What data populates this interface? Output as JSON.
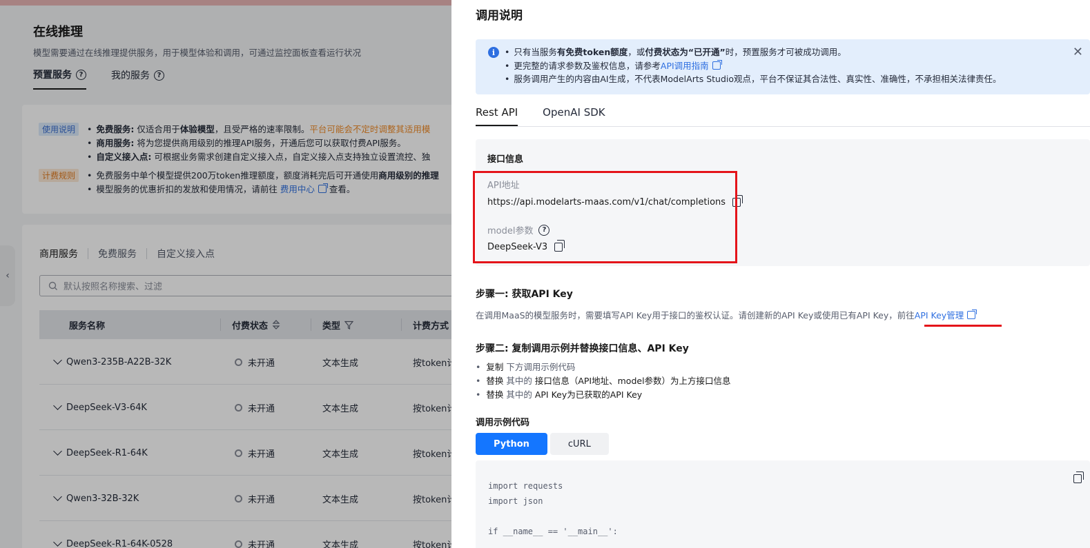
{
  "bg": {
    "title": "在线推理",
    "subtitle": "模型需要通过在线推理提供服务，用于模型体验和调用，可通过监控面板查看运行状况",
    "tabs": [
      "预置服务",
      "我的服务"
    ],
    "usage_tag": "使用说明",
    "usage_items": [
      {
        "bold": "免费服务:",
        "text": " 仅适合用于",
        "bold2": "体验模型",
        "text2": "，且受严格的速率限制。",
        "orange": "平台可能会不定时调整其适用模"
      },
      {
        "bold": "商用服务:",
        "text": " 将为您提供商用级别的推理API服务，开通后您可以获取付费API服务。"
      },
      {
        "bold": "自定义接入点:",
        "text": " 可根据业务需求创建自定义接入点，自定义接入点支持独立设置流控、独"
      }
    ],
    "billing_tag": "计费规则",
    "billing_items": [
      {
        "text": "免费服务中单个模型提供200万token推理额度，额度消耗完后可开通使用",
        "bold": "商用级别的推理"
      },
      {
        "text": "模型服务的优惠折扣的发放和使用情况，请前往 ",
        "link": "费用中心",
        "text2": " 查看。"
      }
    ],
    "subtabs": [
      "商用服务",
      "免费服务",
      "自定义接入点"
    ],
    "search_placeholder": "默认按照名称搜索、过滤",
    "columns": [
      "服务名称",
      "付费状态",
      "类型",
      "计费方式"
    ],
    "rows": [
      {
        "name": "Qwen3-235B-A22B-32K",
        "status": "未开通",
        "type": "文本生成",
        "billing": "按token计"
      },
      {
        "name": "DeepSeek-V3-64K",
        "status": "未开通",
        "type": "文本生成",
        "billing": "按token计"
      },
      {
        "name": "DeepSeek-R1-64K",
        "status": "未开通",
        "type": "文本生成",
        "billing": "按token计"
      },
      {
        "name": "Qwen3-32B-32K",
        "status": "未开通",
        "type": "文本生成",
        "billing": "按token计"
      },
      {
        "name": "DeepSeek-R1-64K-0528",
        "status": "未开通",
        "type": "文本生成",
        "billing": "按token计"
      }
    ]
  },
  "drawer": {
    "title": "调用说明",
    "alert": {
      "line1_a": "只有当服务",
      "line1_b": "有免费token额度",
      "line1_c": "，或",
      "line1_d": "付费状态为“已开通”",
      "line1_e": "时，预置服务才可被成功调用。",
      "line2_a": "更完整的请求参数及鉴权信息，请参考",
      "line2_link": "API调用指南",
      "line3": "服务调用产生的内容由AI生成，不代表ModelArts Studio观点，平台不保证其合法性、真实性、准确性，不承担相关法律责任。"
    },
    "tabs": [
      "Rest API",
      "OpenAI SDK"
    ],
    "iface": {
      "title": "接口信息",
      "api_label": "API地址",
      "api_value": "https://api.modelarts-maas.com/v1/chat/completions",
      "model_label": "model参数",
      "model_value": "DeepSeek-V3"
    },
    "step1": {
      "title": "步骤一: 获取API Key",
      "desc": "在调用MaaS的模型服务时，需要填写API Key用于接口的鉴权认证。请创建新的API Key或使用已有API Key，前往",
      "link": "API Key管理"
    },
    "step2": {
      "title": "步骤二: 复制调用示例并替换接口信息、API Key",
      "items": [
        {
          "a": "复制",
          "b": " 下方调用示例代码",
          "c": ""
        },
        {
          "a": "替换",
          "b": " 其中的 ",
          "c": "接口信息（API地址、model参数）为上方接口信息"
        },
        {
          "a": "替换",
          "b": " 其中的 ",
          "c": "API Key为已获取的API Key"
        }
      ]
    },
    "code_label": "调用示例代码",
    "langs": [
      "Python",
      "cURL"
    ],
    "code": [
      "import requests",
      "import json",
      "",
      "if __name__ == '__main__':"
    ]
  },
  "colors": {
    "accent": "#1476ff",
    "highlight_red": "#e4141a",
    "link": "#2e6fe0"
  }
}
